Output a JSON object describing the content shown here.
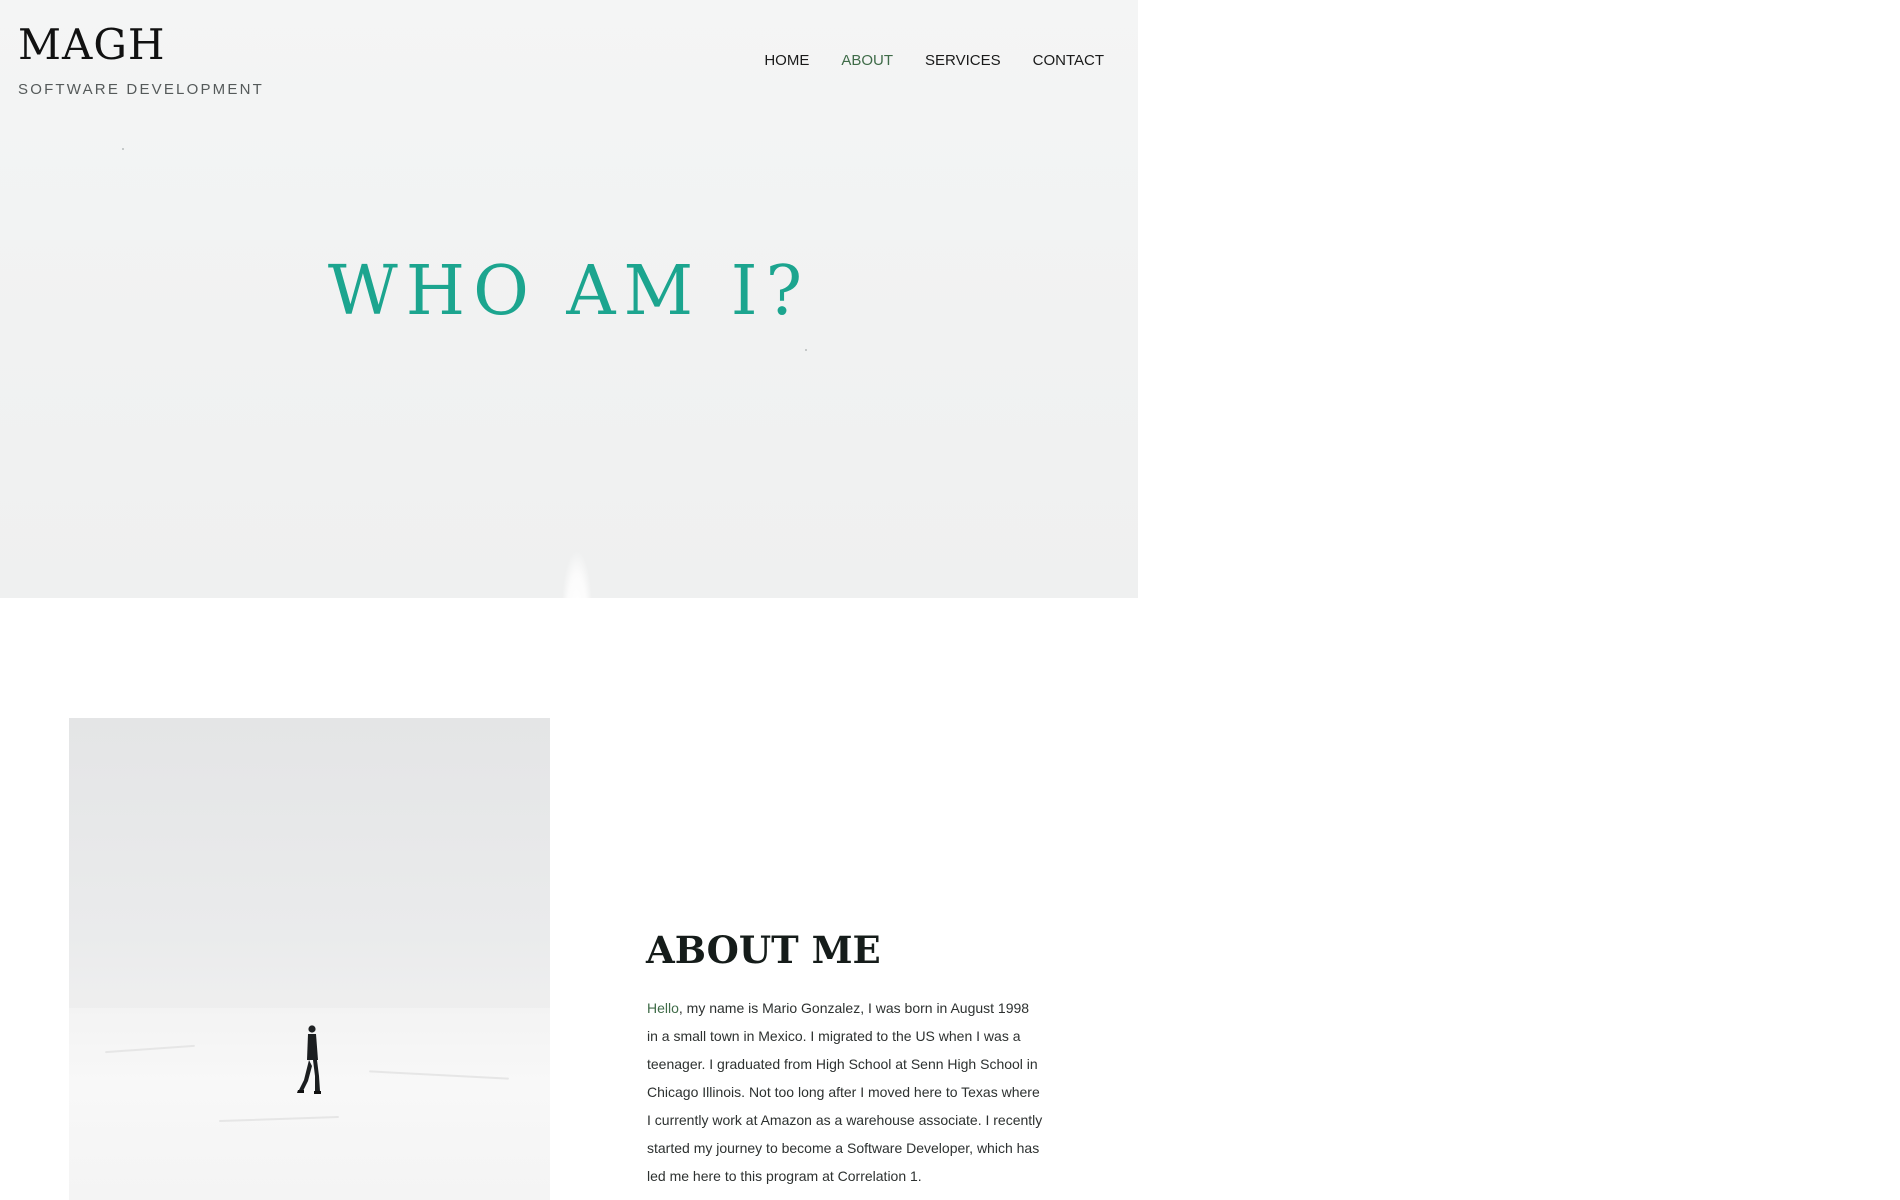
{
  "brand": {
    "title": "MAGH",
    "subtitle": "SOFTWARE DEVELOPMENT"
  },
  "nav": {
    "items": [
      {
        "label": "HOME",
        "active": false
      },
      {
        "label": "ABOUT",
        "active": true
      },
      {
        "label": "SERVICES",
        "active": false
      },
      {
        "label": "CONTACT",
        "active": false
      }
    ]
  },
  "hero": {
    "heading": "WHO AM I?",
    "background_icon": "white-landscape-image"
  },
  "about": {
    "image_icon": "person-walking-in-snow-photo",
    "title": "ABOUT ME",
    "greeting": "Hello",
    "body": ", my name is Mario Gonzalez, I was born in August 1998 in a small town in Mexico. I migrated to the US when I was a teenager. I graduated from High School at Senn High School in Chicago Illinois. Not too long after I moved here to Texas where I currently work at Amazon as a warehouse associate. I recently started my journey to become a Software Developer, which has led me here to this program at Correlation 1."
  },
  "colors": {
    "accent": "#1ca58f",
    "nav_active": "#3f6b48",
    "heading_dark": "#151c1a",
    "hero_bg": "#f2f3f3"
  }
}
